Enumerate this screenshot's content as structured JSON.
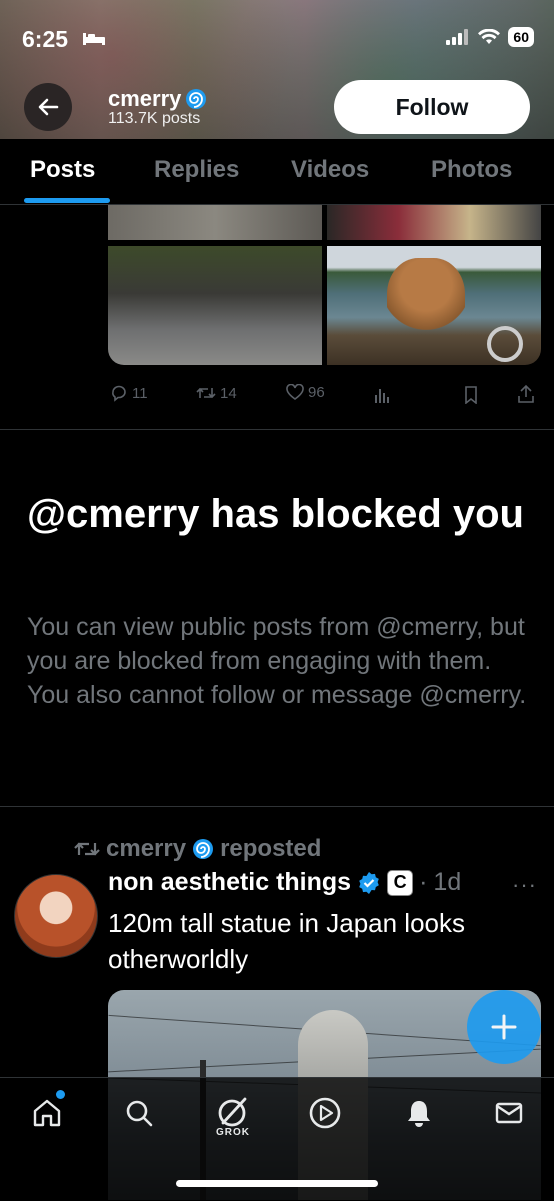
{
  "status_bar": {
    "time": "6:25",
    "battery": "60"
  },
  "header": {
    "name": "cmerry",
    "posts_count": "113.7K posts",
    "follow_label": "Follow"
  },
  "tabs": [
    {
      "label": "Posts",
      "active": true
    },
    {
      "label": "Replies",
      "active": false
    },
    {
      "label": "Videos",
      "active": false
    },
    {
      "label": "Photos",
      "active": false
    }
  ],
  "previous_post": {
    "replies": "11",
    "reposts": "14",
    "likes": "96"
  },
  "blocked": {
    "title": "@cmerry has blocked you",
    "description": "You can view public posts from @cmerry, but you are blocked from engaging with them. You also cannot follow or message @cmerry."
  },
  "repost": {
    "reposter": "cmerry",
    "reposted_label": "reposted",
    "author": "non aesthetic things",
    "badge": "C",
    "separator": "·",
    "time": "1d",
    "more": "···",
    "text": "120m tall statue in Japan looks otherworldly"
  },
  "bottom_nav": {
    "grok_label": "GROK"
  },
  "colors": {
    "accent": "#1d9bf0",
    "background": "#000000",
    "muted": "#71767b"
  }
}
